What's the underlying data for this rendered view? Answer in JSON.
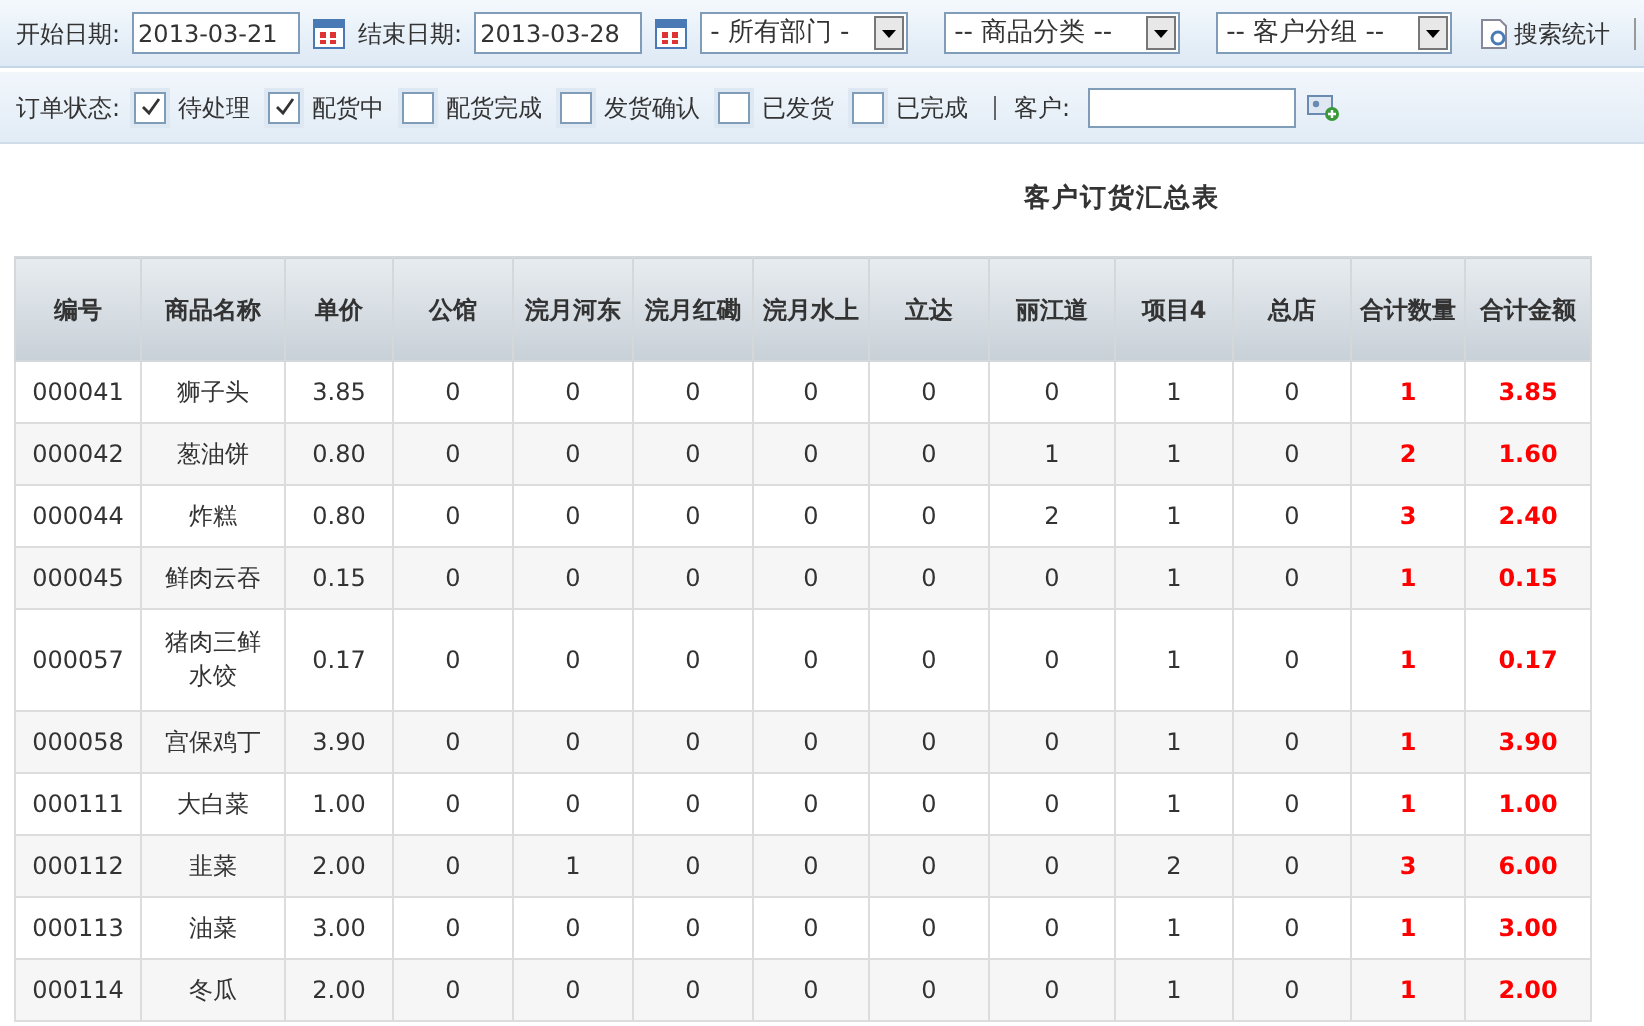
{
  "toolbar": {
    "start_label": "开始日期:",
    "start_date": "2013-03-21",
    "end_label": "结束日期:",
    "end_date": "2013-03-28",
    "selects": [
      "- 所有部门 -",
      "-- 商品分类 --",
      "-- 客户分组 --"
    ],
    "search_button": "搜索统计"
  },
  "filters": {
    "status_label": "订单状态:",
    "statuses": [
      {
        "label": "待处理",
        "checked": true
      },
      {
        "label": "配货中",
        "checked": true
      },
      {
        "label": "配货完成",
        "checked": false
      },
      {
        "label": "发货确认",
        "checked": false
      },
      {
        "label": "已发货",
        "checked": false
      },
      {
        "label": "已完成",
        "checked": false
      }
    ],
    "customer_label": "客户:"
  },
  "report": {
    "title": "客户订货汇总表",
    "columns": [
      "编号",
      "商品名称",
      "单价",
      "公馆",
      "浣月河东",
      "浣月红磡",
      "浣月水上",
      "立达",
      "丽江道",
      "项目4",
      "总店",
      "合计数量",
      "合计金额"
    ],
    "rows": [
      [
        "000041",
        "狮子头",
        "3.85",
        "0",
        "0",
        "0",
        "0",
        "0",
        "0",
        "1",
        "0",
        "1",
        "3.85"
      ],
      [
        "000042",
        "葱油饼",
        "0.80",
        "0",
        "0",
        "0",
        "0",
        "0",
        "1",
        "1",
        "0",
        "2",
        "1.60"
      ],
      [
        "000044",
        "炸糕",
        "0.80",
        "0",
        "0",
        "0",
        "0",
        "0",
        "2",
        "1",
        "0",
        "3",
        "2.40"
      ],
      [
        "000045",
        "鲜肉云吞",
        "0.15",
        "0",
        "0",
        "0",
        "0",
        "0",
        "0",
        "1",
        "0",
        "1",
        "0.15"
      ],
      [
        "000057",
        "猪肉三鲜水饺",
        "0.17",
        "0",
        "0",
        "0",
        "0",
        "0",
        "0",
        "1",
        "0",
        "1",
        "0.17"
      ],
      [
        "000058",
        "宫保鸡丁",
        "3.90",
        "0",
        "0",
        "0",
        "0",
        "0",
        "0",
        "1",
        "0",
        "1",
        "3.90"
      ],
      [
        "000111",
        "大白菜",
        "1.00",
        "0",
        "0",
        "0",
        "0",
        "0",
        "0",
        "1",
        "0",
        "1",
        "1.00"
      ],
      [
        "000112",
        "韭菜",
        "2.00",
        "0",
        "1",
        "0",
        "0",
        "0",
        "0",
        "2",
        "0",
        "3",
        "6.00"
      ],
      [
        "000113",
        "油菜",
        "3.00",
        "0",
        "0",
        "0",
        "0",
        "0",
        "0",
        "1",
        "0",
        "1",
        "3.00"
      ],
      [
        "000114",
        "冬瓜",
        "2.00",
        "0",
        "0",
        "0",
        "0",
        "0",
        "0",
        "1",
        "0",
        "1",
        "2.00"
      ]
    ]
  }
}
